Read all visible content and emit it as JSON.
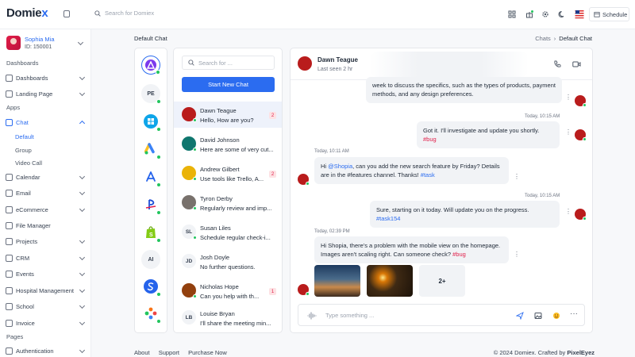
{
  "brand": {
    "name_main": "Domie",
    "name_accent": "x"
  },
  "topbar": {
    "search_placeholder": "Search for Domiex",
    "schedule_label": "Schedule",
    "icons": [
      "apps-grid-icon",
      "gift-icon",
      "settings-icon",
      "moon-icon",
      "flag-icon",
      "calendar-icon"
    ]
  },
  "user": {
    "name": "Sophia Mia",
    "id": "ID: 150001"
  },
  "sidebar": {
    "sections": [
      "Dashboards",
      "Apps",
      "Pages"
    ],
    "items": [
      {
        "label": "Dashboards"
      },
      {
        "label": "Landing Page"
      },
      {
        "label": "Chat"
      },
      {
        "label": "Calendar"
      },
      {
        "label": "Email"
      },
      {
        "label": "eCommerce"
      },
      {
        "label": "File Manager"
      },
      {
        "label": "Projects"
      },
      {
        "label": "CRM"
      },
      {
        "label": "Events"
      },
      {
        "label": "Hospital Management"
      },
      {
        "label": "School"
      },
      {
        "label": "Invoice"
      },
      {
        "label": "Authentication"
      }
    ],
    "chat_sub": [
      "Default",
      "Group",
      "Video Call"
    ]
  },
  "page": {
    "title": "Default Chat",
    "breadcrumb_parent": "Chats",
    "breadcrumb_current": "Default Chat"
  },
  "apps_column": {
    "items": [
      "",
      "PE",
      "",
      "",
      "",
      "",
      "",
      "AI",
      "",
      ""
    ]
  },
  "chat_list": {
    "search_placeholder": "Search for ...",
    "new_chat_label": "Start New Chat",
    "conversations": [
      {
        "name": "Dawn Teague",
        "message": "Hello, How are you?",
        "badge": "2",
        "initials": ""
      },
      {
        "name": "David Johnson",
        "message": "Here are some of very cut...",
        "badge": "",
        "initials": ""
      },
      {
        "name": "Andrew Gilbert",
        "message": "Use tools like Trello, A...",
        "badge": "2",
        "initials": ""
      },
      {
        "name": "Tyron Derby",
        "message": "Regularly review and imp...",
        "badge": "",
        "initials": ""
      },
      {
        "name": "Susan Liles",
        "message": "Schedule regular check-i...",
        "badge": "",
        "initials": "SL"
      },
      {
        "name": "Josh Doyle",
        "message": "No further questions.",
        "badge": "",
        "initials": "JD"
      },
      {
        "name": "Nicholas Hope",
        "message": "Can you help with th...",
        "badge": "1",
        "initials": ""
      },
      {
        "name": "Louise Bryan",
        "message": "I'll share the meeting min...",
        "badge": "",
        "initials": "LB"
      }
    ]
  },
  "chat": {
    "contact_name": "Dawn Teague",
    "contact_status": "Last seen 2 hr",
    "messages": [
      {
        "text": "week to discuss the specifics, such as the types of products, payment methods, and any design preferences."
      },
      {
        "time": "Today, 10:15 AM",
        "text": "Got it. I'll investigate and update you shortly.",
        "tag": "#bug"
      },
      {
        "time": "Today, 10:11 AM",
        "pre": "Hi ",
        "mention": "@Shopia",
        "text": ", can you add the new search feature by Friday? Details are in the #features channel. Thanks! ",
        "tag": "#task"
      },
      {
        "time": "Today, 10:15 AM",
        "text": "Sure, starting on it today. Will update you on the progress. ",
        "tag": "#task154"
      },
      {
        "time": "Today, 02:39 PM",
        "text": "Hi Shopia, there's a problem with the mobile view on the homepage. Images aren't scaling right. Can someone check? ",
        "tag": "#bug",
        "more_photos": "2+"
      }
    ],
    "composer_placeholder": "Type something ..."
  },
  "footer": {
    "links": [
      "About",
      "Support",
      "Purchase Now"
    ],
    "copyright": "© 2024 Domiex. Crafted by ",
    "author": "PixelEyez"
  },
  "colors": {
    "accent": "#2b6cf0",
    "online": "#22c55e",
    "tag": "#e11d48"
  }
}
